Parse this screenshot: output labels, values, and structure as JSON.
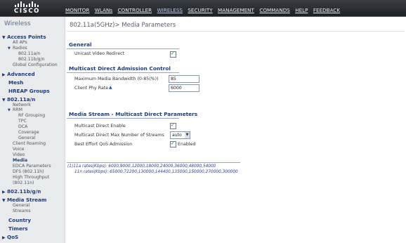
{
  "brand": {
    "logo_text": "CISCO"
  },
  "menu": [
    {
      "label": "MONITOR"
    },
    {
      "label": "WLANs"
    },
    {
      "label": "CONTROLLER"
    },
    {
      "label": "WIRELESS"
    },
    {
      "label": "SECURITY"
    },
    {
      "label": "MANAGEMENT"
    },
    {
      "label": "COMMANDS"
    },
    {
      "label": "HELP"
    },
    {
      "label": "FEEDBACK"
    }
  ],
  "sidebar": {
    "title": "Wireless",
    "access_points": {
      "label": "Access Points",
      "all_aps": "All APs",
      "radios": "Radios",
      "radio_a": "802.11a/n",
      "radio_bg": "802.11b/g/n",
      "global_config": "Global Configuration"
    },
    "advanced": "Advanced",
    "mesh": "Mesh",
    "hreap": "HREAP Groups",
    "a_n": {
      "label": "802.11a/n",
      "network": "Network",
      "rrm": "RRM",
      "rf_grouping": "RF Grouping",
      "tpc": "TPC",
      "dca": "DCA",
      "coverage": "Coverage",
      "general": "General",
      "client_roaming": "Client Roaming",
      "voice": "Voice",
      "video": "Video",
      "media": "Media",
      "edca": "EDCA Parameters",
      "dfs": "DFS (802.11h)",
      "high_throughput": "High Throughput",
      "high_throughput_2": "(802.11n)"
    },
    "b_g_n": "802.11b/g/n",
    "media_stream": {
      "label": "Media Stream",
      "general": "General",
      "streams": "Streams"
    },
    "country": "Country",
    "timers": "Timers",
    "qos": "QoS"
  },
  "main": {
    "title": "802.11a(5GHz)> Media Parameters",
    "general": {
      "heading": "General",
      "unicast_label": "Unicast Video Redirect",
      "unicast_checked": "✓"
    },
    "mdac": {
      "heading": "Multicast Direct Admission Control",
      "max_bw_label": "Maximum Media Bandwidth (0-85(%))",
      "max_bw_value": "85",
      "phy_rate_label": "Client Phy Rate",
      "phy_rate_value": "6000"
    },
    "media_stream": {
      "heading": "Media Stream - Multicast Direct Parameters",
      "enable_label": "Multicast Direct Enable",
      "enable_checked": "✓",
      "max_streams_label": "Multicast Direct Max Number of Streams",
      "max_streams_value": "auto",
      "qos_label": "Best Effort QoS Admission",
      "qos_checked": "✓",
      "qos_suffix": "Enabled"
    },
    "notes": {
      "line1": "(1)11a rates(Kbps): 6000,9000,12000,18000,24000,36000,48000,54000",
      "line2": "11n rates(Kbps): 65000,72200,130000,144400,135000,150000,270000,300000"
    }
  }
}
